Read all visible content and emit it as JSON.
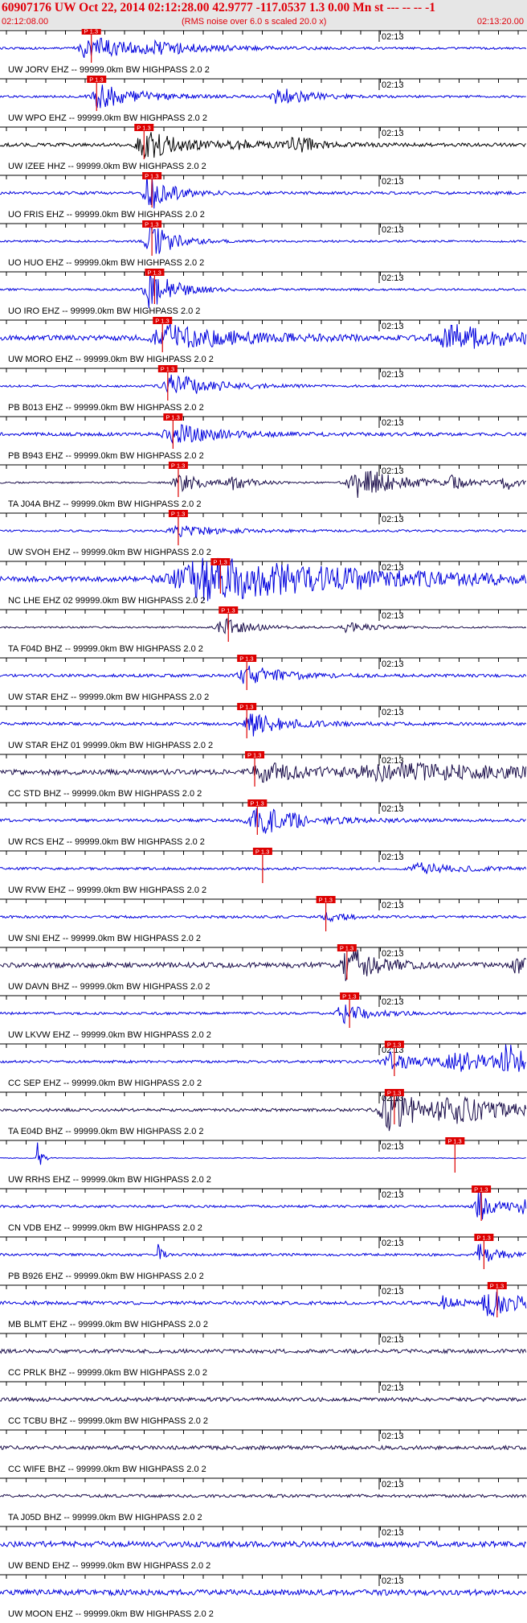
{
  "header": {
    "title": "60907176 UW Oct 22, 2014 02:12:28.00   42.9777 -117.0537  1.3 0.00 Mn st --- -- --  -1",
    "start_time": "02:12:08.00",
    "note": "(RMS noise over 6.0 s scaled 20.0 x)",
    "end_time": "02:13:20.00"
  },
  "minute_label": "02:13",
  "pick_label": "P 1.3",
  "colors": {
    "blue": "#0000dd",
    "dark": "#1a0d4a",
    "black": "#000000",
    "pick_box": "#dd0000",
    "pick_line": "#dd0000",
    "header_text": "#e0000a",
    "header_bg": "#e6e6e6"
  },
  "traces": [
    {
      "label": "UW JORV EHZ -- 99999.0km BW  HIGHPASS  2.0  2",
      "color": "blue",
      "pick": 0.155,
      "events": [
        [
          0.17,
          0.6,
          0.05
        ],
        [
          0.3,
          0.2,
          0.08
        ]
      ],
      "noise": 0.05
    },
    {
      "label": "UW WPO EHZ -- 99999.0km BW  HIGHPASS  2.0  2",
      "color": "blue",
      "pick": 0.165,
      "events": [
        [
          0.19,
          0.55,
          0.05
        ],
        [
          0.53,
          0.4,
          0.04
        ]
      ],
      "noise": 0.05
    },
    {
      "label": "UW IZEE HHZ -- 99999.0km BW  HIGHPASS  2.0  2",
      "color": "black",
      "pick": 0.255,
      "events": [
        [
          0.275,
          0.75,
          0.04
        ],
        [
          0.45,
          0.15,
          0.05
        ],
        [
          0.56,
          0.35,
          0.03
        ]
      ],
      "noise": 0.08
    },
    {
      "label": "UO FRIS EHZ -- 99999.0km BW  HIGHPASS  2.0  2",
      "color": "blue",
      "pick": 0.27,
      "events": [
        [
          0.28,
          0.95,
          0.025
        ]
      ],
      "noise": 0.07
    },
    {
      "label": "UO HUO EHZ -- 99999.0km BW  HIGHPASS  2.0  2",
      "color": "blue",
      "pick": 0.27,
      "events": [
        [
          0.285,
          0.95,
          0.025
        ]
      ],
      "noise": 0.05
    },
    {
      "label": "UO IRO EHZ -- 99999.0km BW  HIGHPASS  2.0  2",
      "color": "blue",
      "pick": 0.275,
      "events": [
        [
          0.285,
          0.9,
          0.03
        ]
      ],
      "noise": 0.05
    },
    {
      "label": "UW MORO EHZ -- 99999.0km BW  HIGHPASS  2.0  2",
      "color": "blue",
      "pick": 0.29,
      "events": [
        [
          0.32,
          0.6,
          0.08
        ],
        [
          0.86,
          0.55,
          0.08
        ]
      ],
      "noise": 0.12
    },
    {
      "label": "PB B013 EHZ -- 99999.0km BW  HIGHPASS  2.0  2",
      "color": "blue",
      "pick": 0.3,
      "events": [
        [
          0.33,
          0.55,
          0.05
        ]
      ],
      "noise": 0.05
    },
    {
      "label": "PB B943 EHZ -- 99999.0km BW  HIGHPASS  2.0  2",
      "color": "blue",
      "pick": 0.31,
      "events": [
        [
          0.33,
          0.5,
          0.05
        ]
      ],
      "noise": 0.08
    },
    {
      "label": "TA J04A BHZ -- 99999.0km BW  HIGHPASS  2.0  2",
      "color": "dark",
      "pick": 0.32,
      "events": [
        [
          0.34,
          0.45,
          0.03
        ],
        [
          0.44,
          0.35,
          0.02
        ],
        [
          0.68,
          0.75,
          0.05
        ],
        [
          0.86,
          0.3,
          0.02
        ],
        [
          0.96,
          0.35,
          0.02
        ]
      ],
      "noise": 0.04
    },
    {
      "label": "UW SVOH EHZ -- 99999.0km BW  HIGHPASS  2.0  2",
      "color": "blue",
      "pick": 0.32,
      "events": [
        [
          0.34,
          0.25,
          0.05
        ]
      ],
      "noise": 0.05
    },
    {
      "label": "NC LHE EHZ 02 99999.0km BW  HIGHPASS  2.0  2",
      "color": "blue",
      "pick": 0.4,
      "events": [
        [
          0.4,
          1.0,
          0.19
        ]
      ],
      "noise": 0.12
    },
    {
      "label": "TA F04D BHZ -- 99999.0km BW  HIGHPASS  2.0  2",
      "color": "dark",
      "pick": 0.415,
      "events": [
        [
          0.42,
          0.5,
          0.03
        ],
        [
          0.66,
          0.25,
          0.03
        ]
      ],
      "noise": 0.04
    },
    {
      "label": "UW STAR EHZ -- 99999.0km BW  HIGHPASS  2.0  2",
      "color": "blue",
      "pick": 0.45,
      "events": [
        [
          0.47,
          0.55,
          0.04
        ]
      ],
      "noise": 0.07
    },
    {
      "label": "UW STAR EHZ 01 99999.0km BW  HIGHPASS  2.0  2",
      "color": "blue",
      "pick": 0.45,
      "events": [
        [
          0.48,
          0.55,
          0.04
        ]
      ],
      "noise": 0.07
    },
    {
      "label": "CC STD BHZ -- 99999.0km BW  HIGHPASS  2.0  2",
      "color": "dark",
      "pick": 0.465,
      "events": [
        [
          0.5,
          0.4,
          0.06
        ],
        [
          0.75,
          0.35,
          0.2
        ]
      ],
      "noise": 0.12
    },
    {
      "label": "UW RCS EHZ -- 99999.0km BW  HIGHPASS  2.0  2",
      "color": "blue",
      "pick": 0.47,
      "events": [
        [
          0.49,
          0.7,
          0.05
        ]
      ],
      "noise": 0.07
    },
    {
      "label": "UW RVW EHZ -- 99999.0km BW  HIGHPASS  2.0  2",
      "color": "blue",
      "pick": 0.48,
      "events": [
        [
          0.8,
          0.25,
          0.05
        ]
      ],
      "noise": 0.06
    },
    {
      "label": "UW SNI EHZ -- 99999.0km BW  HIGHPASS  2.0  2",
      "color": "blue",
      "pick": 0.6,
      "events": [
        [
          0.62,
          0.3,
          0.02
        ]
      ],
      "noise": 0.06
    },
    {
      "label": "UW DAVN BHZ -- 99999.0km BW  HIGHPASS  2.0  2",
      "color": "dark",
      "pick": 0.64,
      "events": [
        [
          0.66,
          0.95,
          0.03
        ],
        [
          0.98,
          0.35,
          0.02
        ]
      ],
      "noise": 0.12
    },
    {
      "label": "UW LKVW EHZ -- 99999.0km BW  HIGHPASS  2.0  2",
      "color": "blue",
      "pick": 0.645,
      "events": [
        [
          0.65,
          0.45,
          0.03
        ]
      ],
      "noise": 0.06
    },
    {
      "label": "CC SEP EHZ -- 99999.0km BW  HIGHPASS  2.0  2",
      "color": "blue",
      "pick": 0.73,
      "events": [
        [
          0.74,
          0.45,
          0.04
        ],
        [
          0.87,
          0.4,
          0.07
        ],
        [
          0.96,
          0.8,
          0.02
        ]
      ],
      "noise": 0.06
    },
    {
      "label": "TA E04D BHZ -- 99999.0km BW  HIGHPASS  2.0  2",
      "color": "dark",
      "pick": 0.73,
      "events": [
        [
          0.74,
          0.95,
          0.05
        ],
        [
          0.86,
          0.45,
          0.08
        ]
      ],
      "noise": 0.07
    },
    {
      "label": "UW RRHS EHZ -- 99999.0km BW  HIGHPASS  2.0  2",
      "color": "blue",
      "pick": 0.845,
      "events": [
        [
          0.07,
          0.9,
          0.005
        ]
      ],
      "noise": 0.02
    },
    {
      "label": "CN VDB EHZ -- 99999.0km BW  HIGHPASS  2.0  2",
      "color": "blue",
      "pick": 0.895,
      "events": [
        [
          0.91,
          0.8,
          0.02
        ],
        [
          0.99,
          0.3,
          0.02
        ]
      ],
      "noise": 0.06
    },
    {
      "label": "PB B926 EHZ -- 99999.0km BW  HIGHPASS  2.0  2",
      "color": "blue",
      "pick": 0.9,
      "events": [
        [
          0.3,
          0.5,
          0.005
        ],
        [
          0.91,
          0.55,
          0.02
        ]
      ],
      "noise": 0.06
    },
    {
      "label": "MB BLMT EHZ -- 99999.0km BW  HIGHPASS  2.0  2",
      "color": "blue",
      "pick": 0.925,
      "events": [
        [
          0.93,
          0.6,
          0.04
        ],
        [
          0.84,
          0.3,
          0.02
        ]
      ],
      "noise": 0.08
    },
    {
      "label": "CC PRLK BHZ -- 99999.0km BW  HIGHPASS  2.0  2",
      "color": "dark",
      "pick": null,
      "events": [],
      "noise": 0.09
    },
    {
      "label": "CC TCBU BHZ -- 99999.0km BW  HIGHPASS  2.0  2",
      "color": "dark",
      "pick": null,
      "events": [],
      "noise": 0.09
    },
    {
      "label": "CC WIFE BHZ -- 99999.0km BW  HIGHPASS  2.0  2",
      "color": "dark",
      "pick": null,
      "events": [],
      "noise": 0.09
    },
    {
      "label": "TA J05D BHZ -- 99999.0km BW  HIGHPASS  2.0  2",
      "color": "dark",
      "pick": null,
      "events": [],
      "noise": 0.07
    },
    {
      "label": "UW BEND EHZ -- 99999.0km BW  HIGHPASS  2.0  2",
      "color": "blue",
      "pick": null,
      "events": [],
      "noise": 0.13
    },
    {
      "label": "UW MOON EHZ -- 99999.0km BW  HIGHPASS  2.0  2",
      "color": "blue",
      "pick": null,
      "events": [],
      "noise": 0.13
    }
  ]
}
